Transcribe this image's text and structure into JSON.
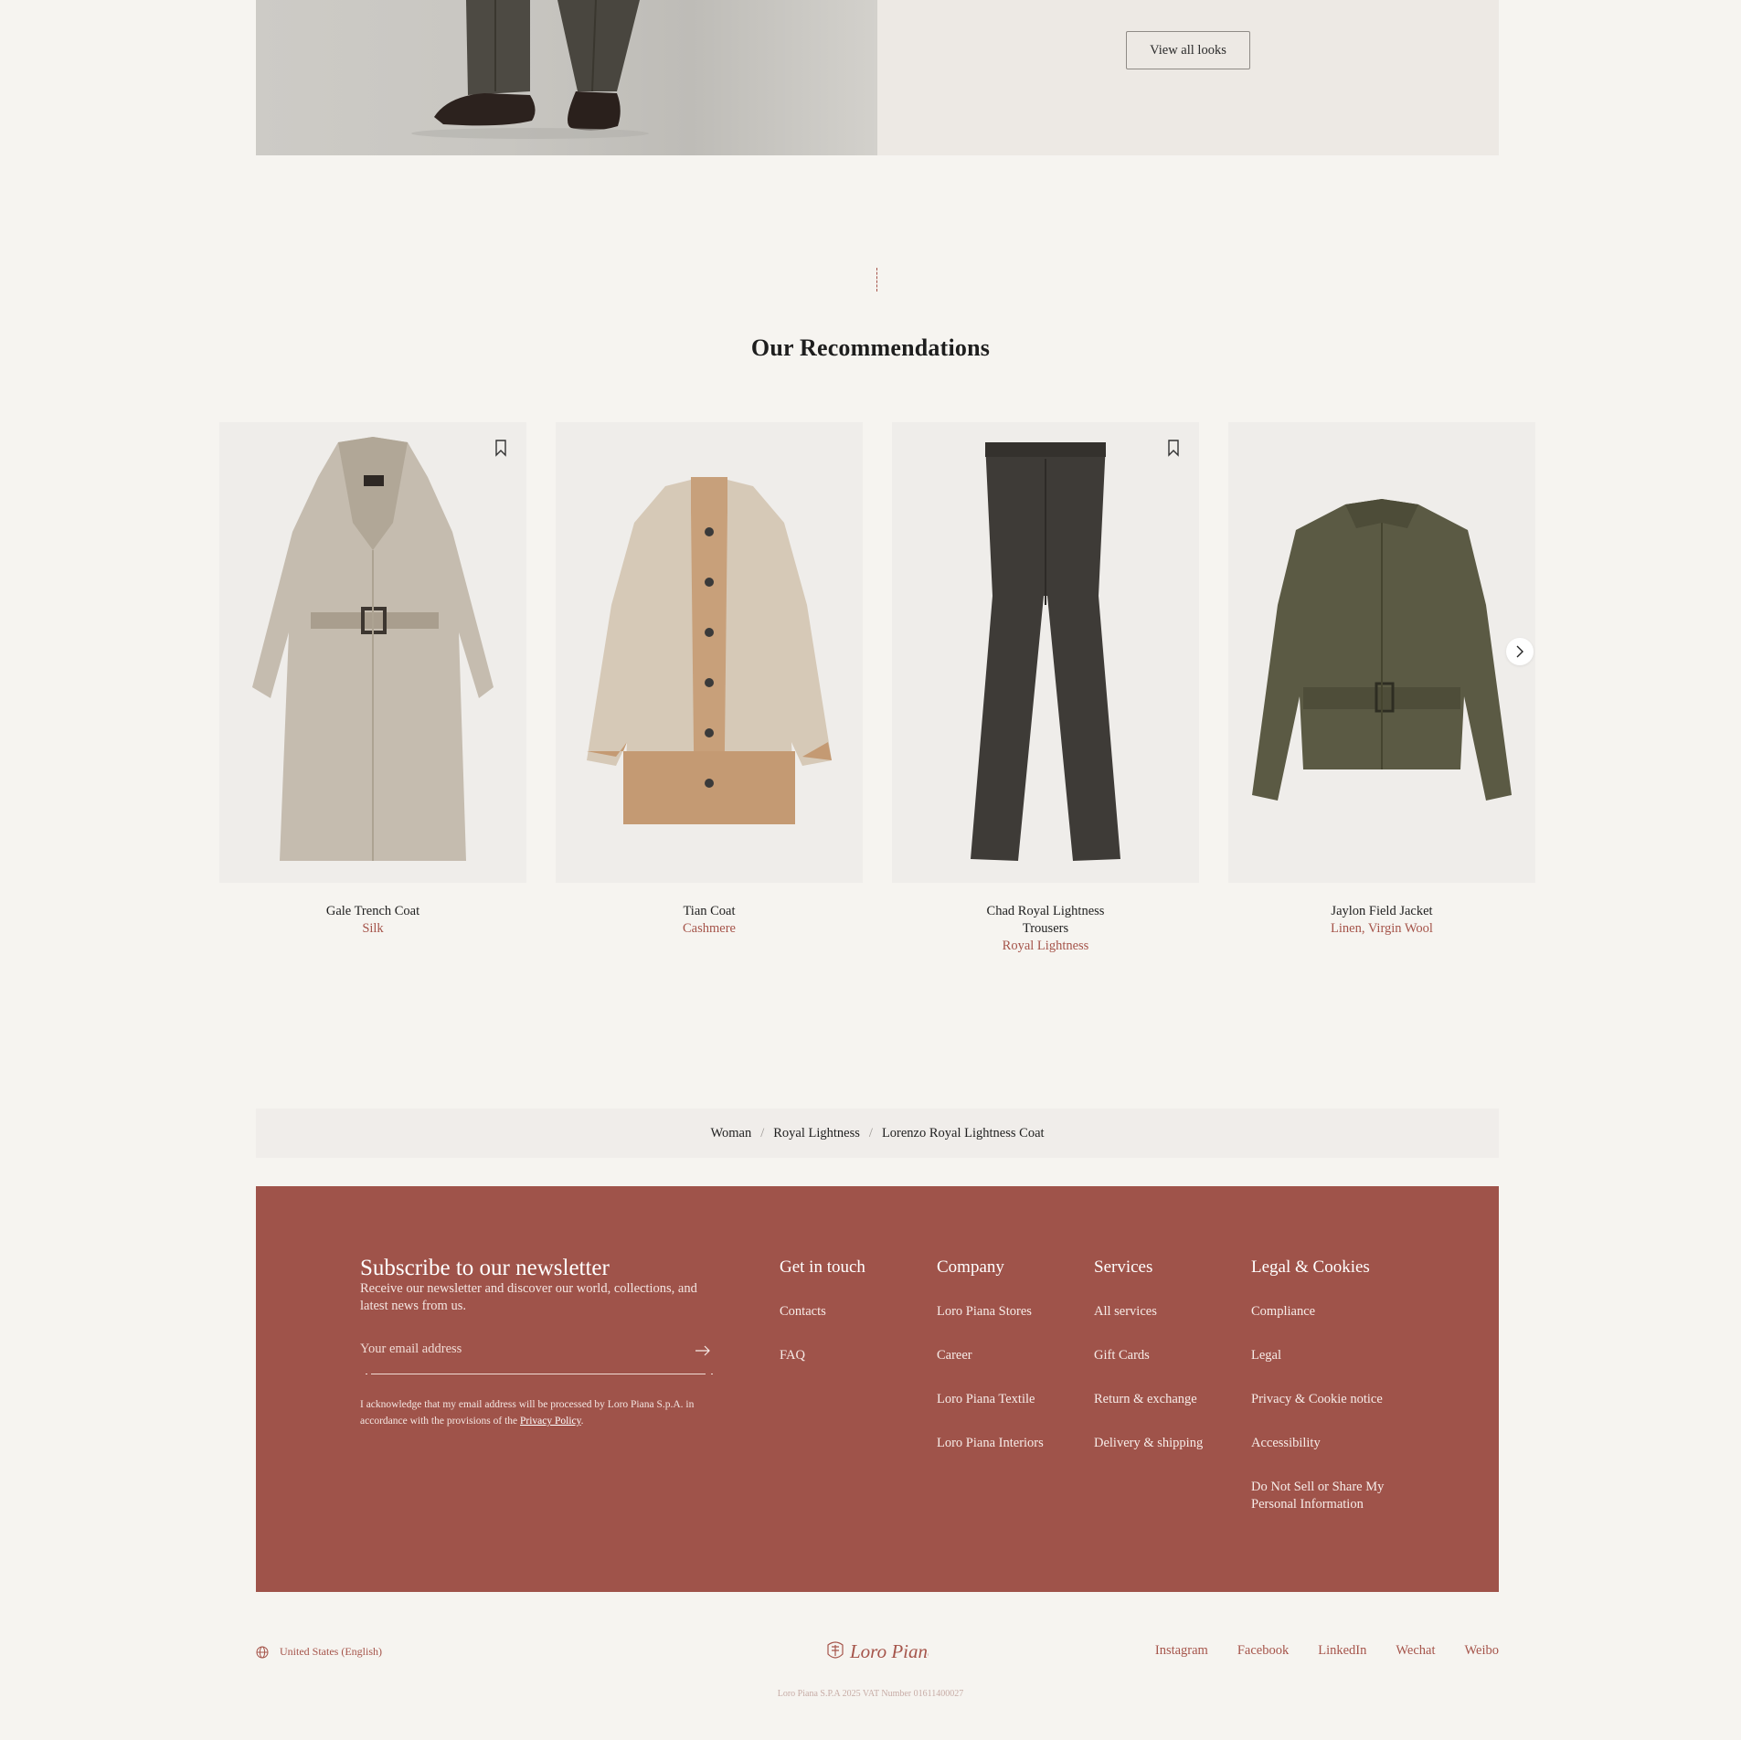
{
  "hero": {
    "view_all_label": "View all looks"
  },
  "recommendations": {
    "title": "Our Recommendations",
    "products": [
      {
        "name": "Gale Trench Coat",
        "material": "Silk",
        "bookmark": true
      },
      {
        "name": "Tian Coat",
        "material": "Cashmere",
        "bookmark": false
      },
      {
        "name": "Chad Royal Lightness Trousers",
        "material": "Royal Lightness",
        "bookmark": true
      },
      {
        "name": "Jaylon Field Jacket",
        "material": "Linen, Virgin Wool",
        "bookmark": false
      }
    ],
    "next_icon": "chevron-right-icon"
  },
  "breadcrumb": {
    "items": [
      "Woman",
      "Royal Lightness",
      "Lorenzo Royal Lightness Coat"
    ],
    "separator": "/"
  },
  "newsletter": {
    "title": "Subscribe to our newsletter",
    "description": "Receive our newsletter and discover our world, collections, and latest news from us.",
    "email_placeholder": "Your email address",
    "legal_text": "I acknowledge that my email address will be processed by Loro Piana S.p.A. in accordance with the provisions of the ",
    "privacy_link": "Privacy Policy",
    "legal_end": "."
  },
  "footer_columns": [
    {
      "title": "Get in touch",
      "links": [
        "Contacts",
        "FAQ"
      ]
    },
    {
      "title": "Company",
      "links": [
        "Loro Piana Stores",
        "Career",
        "Loro Piana Textile",
        "Loro Piana Interiors"
      ]
    },
    {
      "title": "Services",
      "links": [
        "All services",
        "Gift Cards",
        "Return & exchange",
        "Delivery & shipping"
      ]
    },
    {
      "title": "Legal & Cookies",
      "links": [
        "Compliance",
        "Legal",
        "Privacy & Cookie notice",
        "Accessibility",
        "Do Not Sell or Share My Personal Information"
      ]
    }
  ],
  "bottom": {
    "locale": "United States (English)",
    "brand": "Loro Piana",
    "socials": [
      "Instagram",
      "Facebook",
      "LinkedIn",
      "Wechat",
      "Weibo"
    ],
    "copyright": "Loro Piana S.P.A 2025 VAT Number 01611400027"
  },
  "colors": {
    "background": "#f6f4f0",
    "accent": "#a5544a",
    "footer_bg": "#9f534a"
  }
}
